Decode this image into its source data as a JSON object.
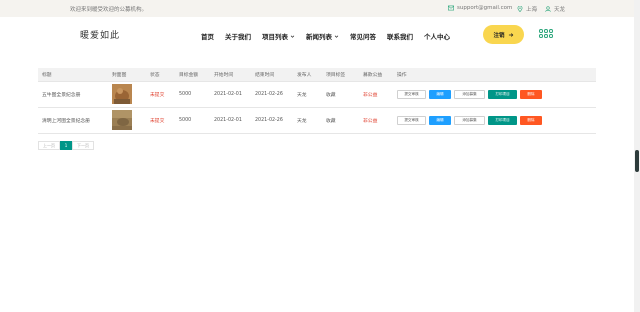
{
  "topbar": {
    "welcome": "欢迎来到暖受欢迎的公募机构。",
    "email": "support@gmail.com",
    "location": "上海",
    "user": "天龙"
  },
  "nav": {
    "logo": "暖爱如此",
    "menu": [
      {
        "label": "首页",
        "has_dropdown": false
      },
      {
        "label": "关于我们",
        "has_dropdown": false
      },
      {
        "label": "项目列表",
        "has_dropdown": true
      },
      {
        "label": "新闻列表",
        "has_dropdown": true
      },
      {
        "label": "常见问答",
        "has_dropdown": false
      },
      {
        "label": "联系我们",
        "has_dropdown": false
      },
      {
        "label": "个人中心",
        "has_dropdown": false
      }
    ],
    "login_button": "注销",
    "accent_color": "#f9d64f"
  },
  "table": {
    "headers": [
      "标题",
      "封面图",
      "状态",
      "目标金额",
      "开始时间",
      "结束时间",
      "发布人",
      "项目标签",
      "募款公益",
      "操作"
    ],
    "rows": [
      {
        "title": "五牛图全景纪念册",
        "cover": "cover-dog-1",
        "status": "未提交",
        "target": "5000",
        "start": "2021-02-01",
        "end": "2021-02-26",
        "publisher": "天龙",
        "tag": "收藏",
        "domain": "非公益"
      },
      {
        "title": "清明上河图全景纪念册",
        "cover": "cover-dog-2",
        "status": "未提交",
        "target": "5000",
        "start": "2021-02-01",
        "end": "2021-02-26",
        "publisher": "天龙",
        "tag": "收藏",
        "domain": "非公益"
      }
    ],
    "actions": {
      "submit": "提交审核",
      "edit": "编辑",
      "donate": "添加募集",
      "print": "打印项目",
      "delete": "删除"
    }
  },
  "pager": {
    "prev": "上一页",
    "current": "1",
    "next": "下一页"
  },
  "colors": {
    "status_red": "#e0412f",
    "edit_blue": "#1e9fff",
    "print_teal": "#009688",
    "delete_orange": "#ff5722"
  }
}
